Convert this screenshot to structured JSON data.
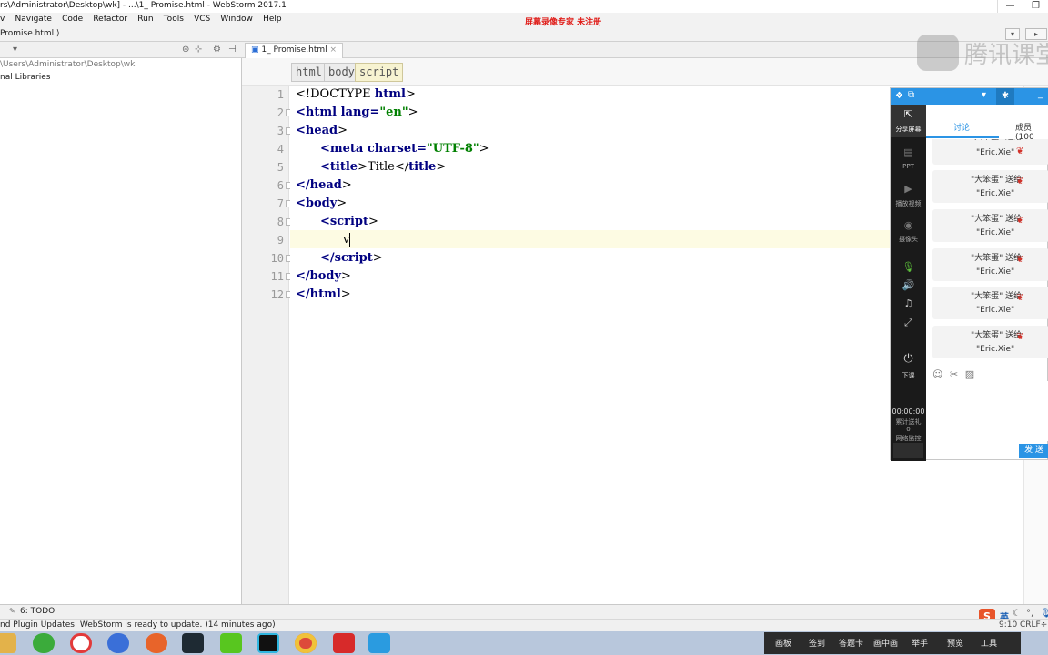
{
  "window": {
    "title": "rs\\Administrator\\Desktop\\wk] - ...\\1_ Promise.html - WebStorm 2017.1",
    "watermark": "屏幕录像专家  未注册",
    "controls": [
      "—",
      "❐"
    ]
  },
  "menu": [
    "v",
    "Navigate",
    "Code",
    "Refactor",
    "Run",
    "Tools",
    "VCS",
    "Window",
    "Help"
  ],
  "navbar": {
    "breadcrumb": "Promise.html ⟩"
  },
  "project": {
    "dropdown": "▾",
    "path": "\\Users\\Administrator\\Desktop\\wk",
    "libraries": "nal Libraries"
  },
  "tab": {
    "label": "1_ Promise.html",
    "close": "×"
  },
  "crumbs": [
    "html",
    "body",
    "script"
  ],
  "line_numbers": [
    "1",
    "2",
    "3",
    "4",
    "5",
    "6",
    "7",
    "8",
    "9",
    "10",
    "11",
    "12"
  ],
  "code": {
    "l1_a": "<!DOCTYPE ",
    "l1_b": "html",
    "l1_c": ">",
    "l2_a": "<html ",
    "l2_b": "lang=",
    "l2_c": "\"en\"",
    "l2_d": ">",
    "l3_a": "<head",
    "l3_b": ">",
    "l4_a": "<meta ",
    "l4_b": "charset=",
    "l4_c": "\"UTF-8\"",
    "l4_d": ">",
    "l5_a": "<title",
    "l5_b": ">Title</",
    "l5_c": "title",
    "l5_d": ">",
    "l6_a": "</head",
    "l6_b": ">",
    "l7_a": "<body",
    "l7_b": ">",
    "l8_a": "<script",
    "l8_b": ">",
    "l9": "v",
    "l10_a": "</script",
    "l10_b": ">",
    "l11_a": "</body",
    "l11_b": ">",
    "l12_a": "</html",
    "l12_b": ">"
  },
  "qq": {
    "logo": "腾讯课堂",
    "sidebar": [
      {
        "icon": "share-screen-icon",
        "glyph": "⇱",
        "label": "分享屏幕"
      },
      {
        "icon": "ppt-icon",
        "glyph": "▤",
        "label": "PPT"
      },
      {
        "icon": "video-icon",
        "glyph": "▶",
        "label": "播放视频"
      },
      {
        "icon": "camera-icon",
        "glyph": "◉",
        "label": "摄像头"
      },
      {
        "icon": "mic-icon",
        "glyph": "🎙",
        "label": ""
      },
      {
        "icon": "speaker-icon",
        "glyph": "🔊",
        "label": ""
      },
      {
        "icon": "music-icon",
        "glyph": "♫",
        "label": ""
      },
      {
        "icon": "fullscreen-icon",
        "glyph": "⤢",
        "label": ""
      }
    ],
    "end_class": "下课",
    "timer": "00:00:00",
    "gifts": "累计送礼\n0",
    "network": "网络监控",
    "tab_discuss": "讨论",
    "tab_members": "成员(100",
    "messages": [
      {
        "from": "\"大笨蛋\"  送给",
        "to": "\"Eric.Xie\""
      },
      {
        "from": "\"大笨蛋\"  送给",
        "to": "\"Eric.Xie\""
      },
      {
        "from": "\"大笨蛋\"  送给",
        "to": "\"Eric.Xie\""
      },
      {
        "from": "\"大笨蛋\"  送给",
        "to": "\"Eric.Xie\""
      },
      {
        "from": "\"大笨蛋\"  送给",
        "to": "\"Eric.Xie\""
      },
      {
        "from": "\"大笨蛋\"  送给",
        "to": "\"Eric.Xie\""
      }
    ],
    "send": "发 送"
  },
  "bottom": {
    "todo": "6: TODO"
  },
  "status": {
    "text": "nd Plugin Updates: WebStorm is ready to update. (14 minutes ago)"
  },
  "tray": [
    "画板",
    "签到",
    "答题卡",
    "画中画",
    "举手",
    "预览",
    "工具"
  ],
  "clock": "9:10",
  "crlf": "CRLF÷",
  "ime": "英"
}
